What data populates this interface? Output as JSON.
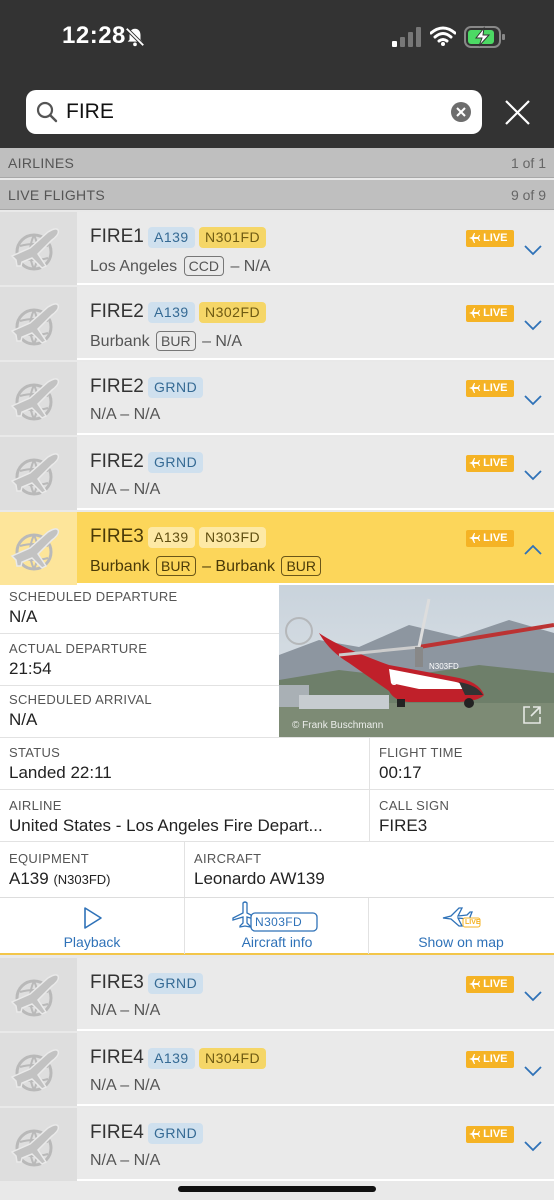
{
  "status_bar": {
    "time": "12:28"
  },
  "search": {
    "value": "FIRE"
  },
  "sections": {
    "airlines": {
      "label": "AIRLINES",
      "count": "1 of 1"
    },
    "live_flights": {
      "label": "LIVE FLIGHTS",
      "count": "9 of 9"
    }
  },
  "live_label": "LIVE",
  "flights": [
    {
      "callsign": "FIRE1",
      "type": "A139",
      "reg": "N301FD",
      "from": "Los Angeles",
      "from_code": "CCD",
      "to": "N/A"
    },
    {
      "callsign": "FIRE2",
      "type": "A139",
      "reg": "N302FD",
      "from": "Burbank",
      "from_code": "BUR",
      "to": "N/A"
    },
    {
      "callsign": "FIRE2",
      "type": "GRND",
      "from": "N/A",
      "to": "N/A"
    },
    {
      "callsign": "FIRE2",
      "type": "GRND",
      "from": "N/A",
      "to": "N/A"
    },
    {
      "callsign": "FIRE3",
      "type": "A139",
      "reg": "N303FD",
      "from": "Burbank",
      "from_code": "BUR",
      "to": "Burbank",
      "to_code": "BUR"
    },
    {
      "callsign": "FIRE3",
      "type": "GRND",
      "from": "N/A",
      "to": "N/A"
    },
    {
      "callsign": "FIRE4",
      "type": "A139",
      "reg": "N304FD",
      "from": "N/A",
      "to": "N/A"
    },
    {
      "callsign": "FIRE4",
      "type": "GRND",
      "from": "N/A",
      "to": "N/A"
    }
  ],
  "details": {
    "scheduled_departure": {
      "label": "SCHEDULED DEPARTURE",
      "value": "N/A"
    },
    "actual_departure": {
      "label": "ACTUAL DEPARTURE",
      "value": "21:54"
    },
    "scheduled_arrival": {
      "label": "SCHEDULED ARRIVAL",
      "value": "N/A"
    },
    "status": {
      "label": "STATUS",
      "value": "Landed 22:11"
    },
    "flight_time": {
      "label": "FLIGHT TIME",
      "value": "00:17"
    },
    "airline": {
      "label": "AIRLINE",
      "value": "United States - Los Angeles Fire Depart..."
    },
    "call_sign": {
      "label": "CALL SIGN",
      "value": "FIRE3"
    },
    "equipment": {
      "label": "EQUIPMENT",
      "value": "A139",
      "reg": "(N303FD)"
    },
    "aircraft": {
      "label": "AIRCRAFT",
      "value": "Leonardo AW139"
    },
    "photo_credit": "© Frank Buschmann",
    "heli_tail_text": "N303FD",
    "heli_number": "3"
  },
  "actions": {
    "playback": "Playback",
    "aircraft_info": "Aircraft info",
    "aircraft_info_badge": "N303FD",
    "show_on_map": "Show on map",
    "map_badge": "LIVE"
  },
  "colors": {
    "accent": "#fcd65a",
    "live_badge": "#f5b325",
    "link": "#2f72b8",
    "header": "#333333"
  }
}
